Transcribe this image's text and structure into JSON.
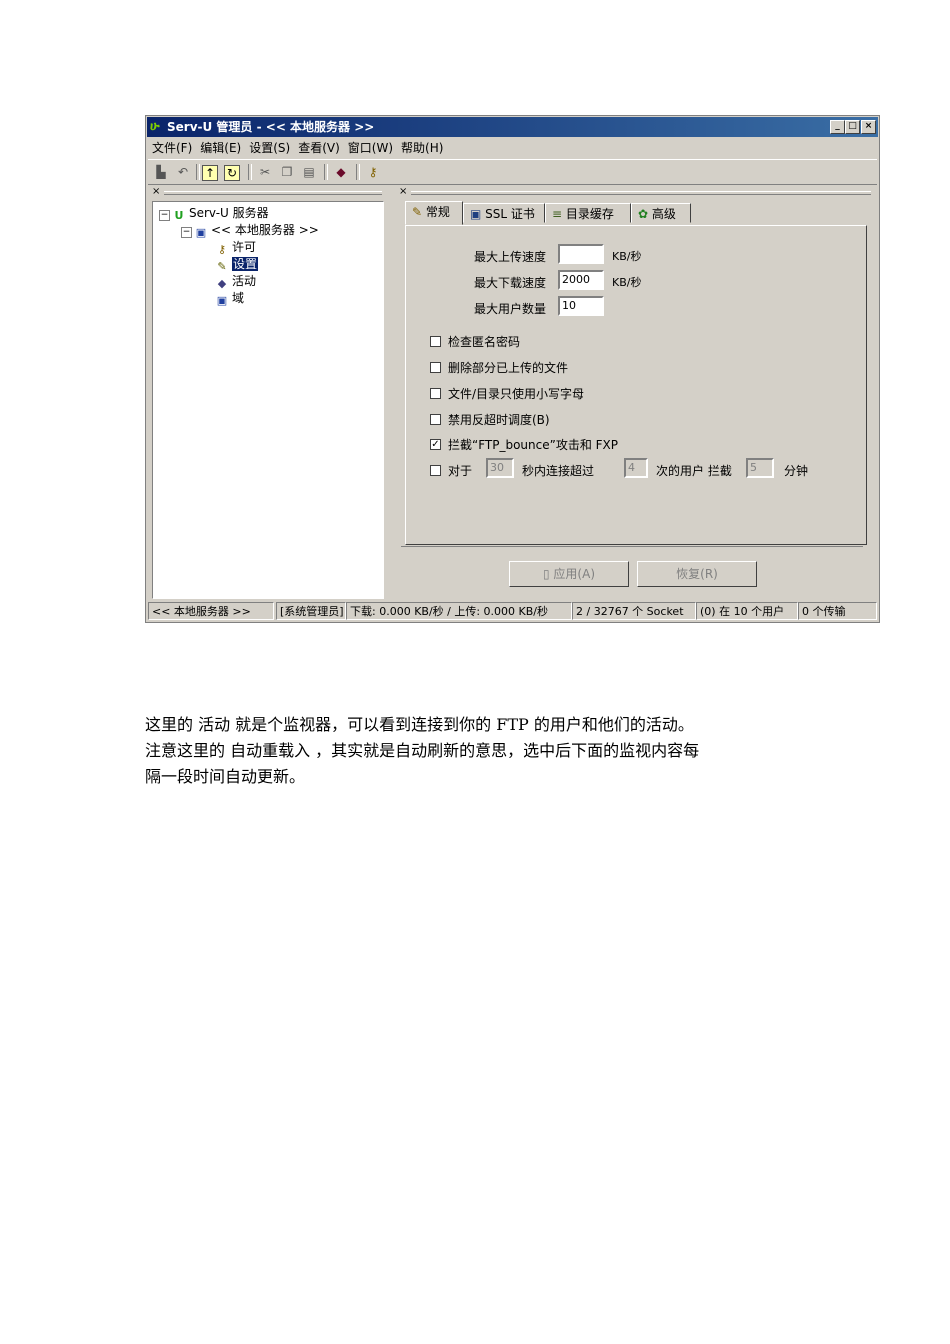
{
  "window": {
    "title": "Serv-U 管理员 - << 本地服务器 >>",
    "app_icon": "serv-u-logo-icon",
    "controls": [
      "_",
      "□",
      "×"
    ]
  },
  "menu": [
    "文件(F)",
    "编辑(E)",
    "设置(S)",
    "查看(V)",
    "窗口(W)",
    "帮助(H)"
  ],
  "toolbar_icons": [
    "save-icon",
    "undo-icon",
    "up-folder-icon",
    "refresh-icon",
    "cut-icon",
    "copy-icon",
    "paste-icon",
    "book-icon",
    "help-icon"
  ],
  "pane_close": "×",
  "tree": {
    "root": "Serv-U 服务器",
    "server": "<< 本地服务器 >>",
    "items": [
      "许可",
      "设置",
      "活动",
      "域"
    ],
    "selected": "设置"
  },
  "tabs": [
    "常规",
    "SSL 证书",
    "目录缓存",
    "高级"
  ],
  "general": {
    "max_upload_label": "最大上传速度",
    "max_upload_value": "",
    "max_upload_unit": "KB/秒",
    "max_download_label": "最大下载速度",
    "max_download_value": "2000",
    "max_download_unit": "KB/秒",
    "max_users_label": "最大用户数量",
    "max_users_value": "10",
    "check_anon": "检查匿名密码",
    "delete_partial": "删除部分已上传的文件",
    "lowercase": "文件/目录只使用小写字母",
    "disable_anti_timeout": "禁用反超时调度(B)",
    "block_bounce": "拦截“FTP_bounce”攻击和 FXP",
    "for_label": "对于",
    "seconds_value": "30",
    "seconds_text": "秒内连接超过",
    "times_value": "4",
    "times_text": "次的用户 拦截",
    "minutes_value": "5",
    "minutes_text": "分钟"
  },
  "buttons": {
    "apply": "应用(A)",
    "restore": "恢复(R)"
  },
  "status": {
    "server": "<< 本地服务器 >>",
    "admin": "[系统管理员]",
    "speed": "下载: 0.000 KB/秒 / 上传: 0.000 KB/秒",
    "sockets": "2 / 32767 个 Socket",
    "users": "(0) 在 10 个用户",
    "transfers": "0 个传输"
  },
  "caption": {
    "line1": "这里的 活动 就是个监视器，可以看到连接到你的 FTP 的用户和他们的活动。",
    "line2": "注意这里的 自动重载入 ，其实就是自动刷新的意思，选中后下面的监视内容每",
    "line3": "隔一段时间自动更新。"
  }
}
